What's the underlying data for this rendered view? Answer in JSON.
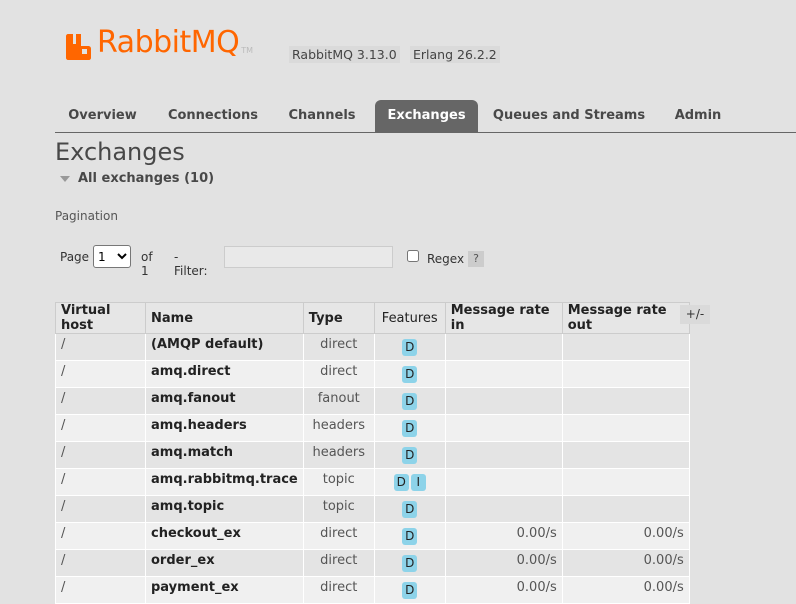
{
  "logo": {
    "text": "RabbitMQ",
    "tm": "TM"
  },
  "versions": {
    "rabbitmq": "RabbitMQ 3.13.0",
    "erlang": "Erlang 26.2.2"
  },
  "tabs": [
    {
      "label": "Overview",
      "active": false
    },
    {
      "label": "Connections",
      "active": false
    },
    {
      "label": "Channels",
      "active": false
    },
    {
      "label": "Exchanges",
      "active": true
    },
    {
      "label": "Queues and Streams",
      "active": false
    },
    {
      "label": "Admin",
      "active": false
    }
  ],
  "page_title": "Exchanges",
  "section_title": "All exchanges (10)",
  "pagination": {
    "label": "Pagination",
    "page_label": "Page",
    "page_value": "1",
    "of_label": "of 1",
    "filter_label": "- Filter:",
    "filter_value": "",
    "regex_label": "Regex",
    "help": "?"
  },
  "table": {
    "headers": [
      "Virtual host",
      "Name",
      "Type",
      "Features",
      "Message rate in",
      "Message rate out"
    ],
    "toggle_columns": "+/-",
    "rows": [
      {
        "vhost": "/",
        "name": "(AMQP default)",
        "type": "direct",
        "features": [
          "D"
        ],
        "rate_in": "",
        "rate_out": ""
      },
      {
        "vhost": "/",
        "name": "amq.direct",
        "type": "direct",
        "features": [
          "D"
        ],
        "rate_in": "",
        "rate_out": ""
      },
      {
        "vhost": "/",
        "name": "amq.fanout",
        "type": "fanout",
        "features": [
          "D"
        ],
        "rate_in": "",
        "rate_out": ""
      },
      {
        "vhost": "/",
        "name": "amq.headers",
        "type": "headers",
        "features": [
          "D"
        ],
        "rate_in": "",
        "rate_out": ""
      },
      {
        "vhost": "/",
        "name": "amq.match",
        "type": "headers",
        "features": [
          "D"
        ],
        "rate_in": "",
        "rate_out": ""
      },
      {
        "vhost": "/",
        "name": "amq.rabbitmq.trace",
        "type": "topic",
        "features": [
          "D",
          "I"
        ],
        "rate_in": "",
        "rate_out": ""
      },
      {
        "vhost": "/",
        "name": "amq.topic",
        "type": "topic",
        "features": [
          "D"
        ],
        "rate_in": "",
        "rate_out": ""
      },
      {
        "vhost": "/",
        "name": "checkout_ex",
        "type": "direct",
        "features": [
          "D"
        ],
        "rate_in": "0.00/s",
        "rate_out": "0.00/s"
      },
      {
        "vhost": "/",
        "name": "order_ex",
        "type": "direct",
        "features": [
          "D"
        ],
        "rate_in": "0.00/s",
        "rate_out": "0.00/s"
      },
      {
        "vhost": "/",
        "name": "payment_ex",
        "type": "direct",
        "features": [
          "D"
        ],
        "rate_in": "0.00/s",
        "rate_out": "0.00/s"
      }
    ]
  },
  "colors": {
    "brand": "#ff6600",
    "active_tab": "#666666",
    "badge": "#8dd3e9"
  }
}
